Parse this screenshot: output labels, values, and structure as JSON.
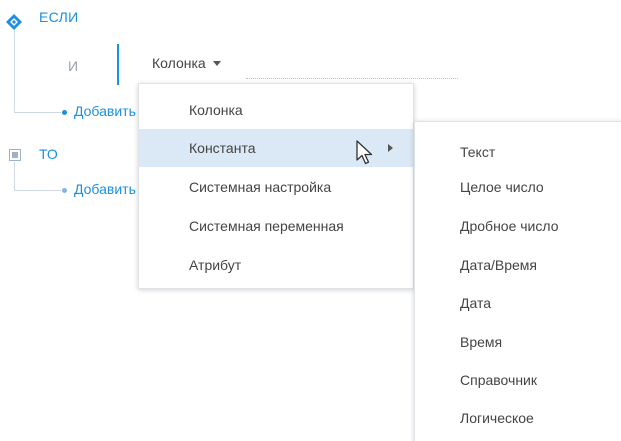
{
  "condition": {
    "if_label": "ЕСЛИ",
    "and_label": "И",
    "column_select": "Колонка",
    "add_link": "Добавить",
    "then_label": "ТО",
    "then_add_link": "Добавить"
  },
  "menu": {
    "items": [
      {
        "label": "Колонка"
      },
      {
        "label": "Константа",
        "active": true,
        "has_submenu": true
      },
      {
        "label": "Системная настройка"
      },
      {
        "label": "Системная переменная"
      },
      {
        "label": "Атрибут"
      }
    ]
  },
  "submenu": {
    "items": [
      {
        "label": "Текст"
      },
      {
        "label": "Целое число"
      },
      {
        "label": "Дробное число"
      },
      {
        "label": "Дата/Время"
      },
      {
        "label": "Дата"
      },
      {
        "label": "Время"
      },
      {
        "label": "Справочник"
      },
      {
        "label": "Логическое"
      }
    ]
  },
  "colors": {
    "accent": "#1b8fe0",
    "highlight": "#dbe8f6"
  }
}
